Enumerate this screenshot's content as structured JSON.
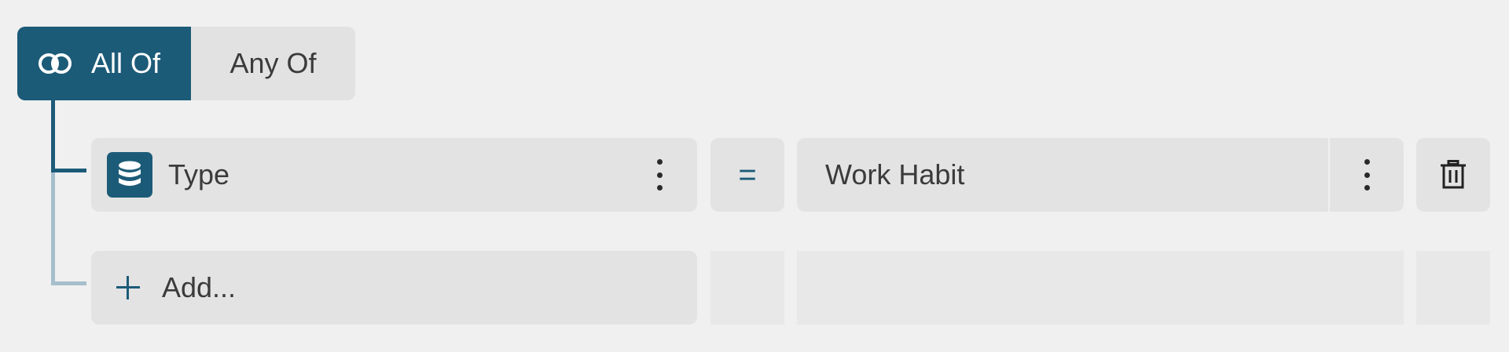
{
  "combinator": {
    "options": [
      "All Of",
      "Any Of"
    ],
    "selected": "All Of",
    "all_of_label": "All Of",
    "any_of_label": "Any Of",
    "active_color": "#1c5b78"
  },
  "condition": {
    "field_label": "Type",
    "field_icon": "database-icon",
    "operator": "=",
    "value": "Work Habit"
  },
  "add_row": {
    "label": "Add..."
  },
  "colors": {
    "accent": "#1c5b78",
    "background": "#f0f0f0",
    "cell": "#e3e3e3",
    "tree_line_inactive": "#a6bfcc"
  }
}
